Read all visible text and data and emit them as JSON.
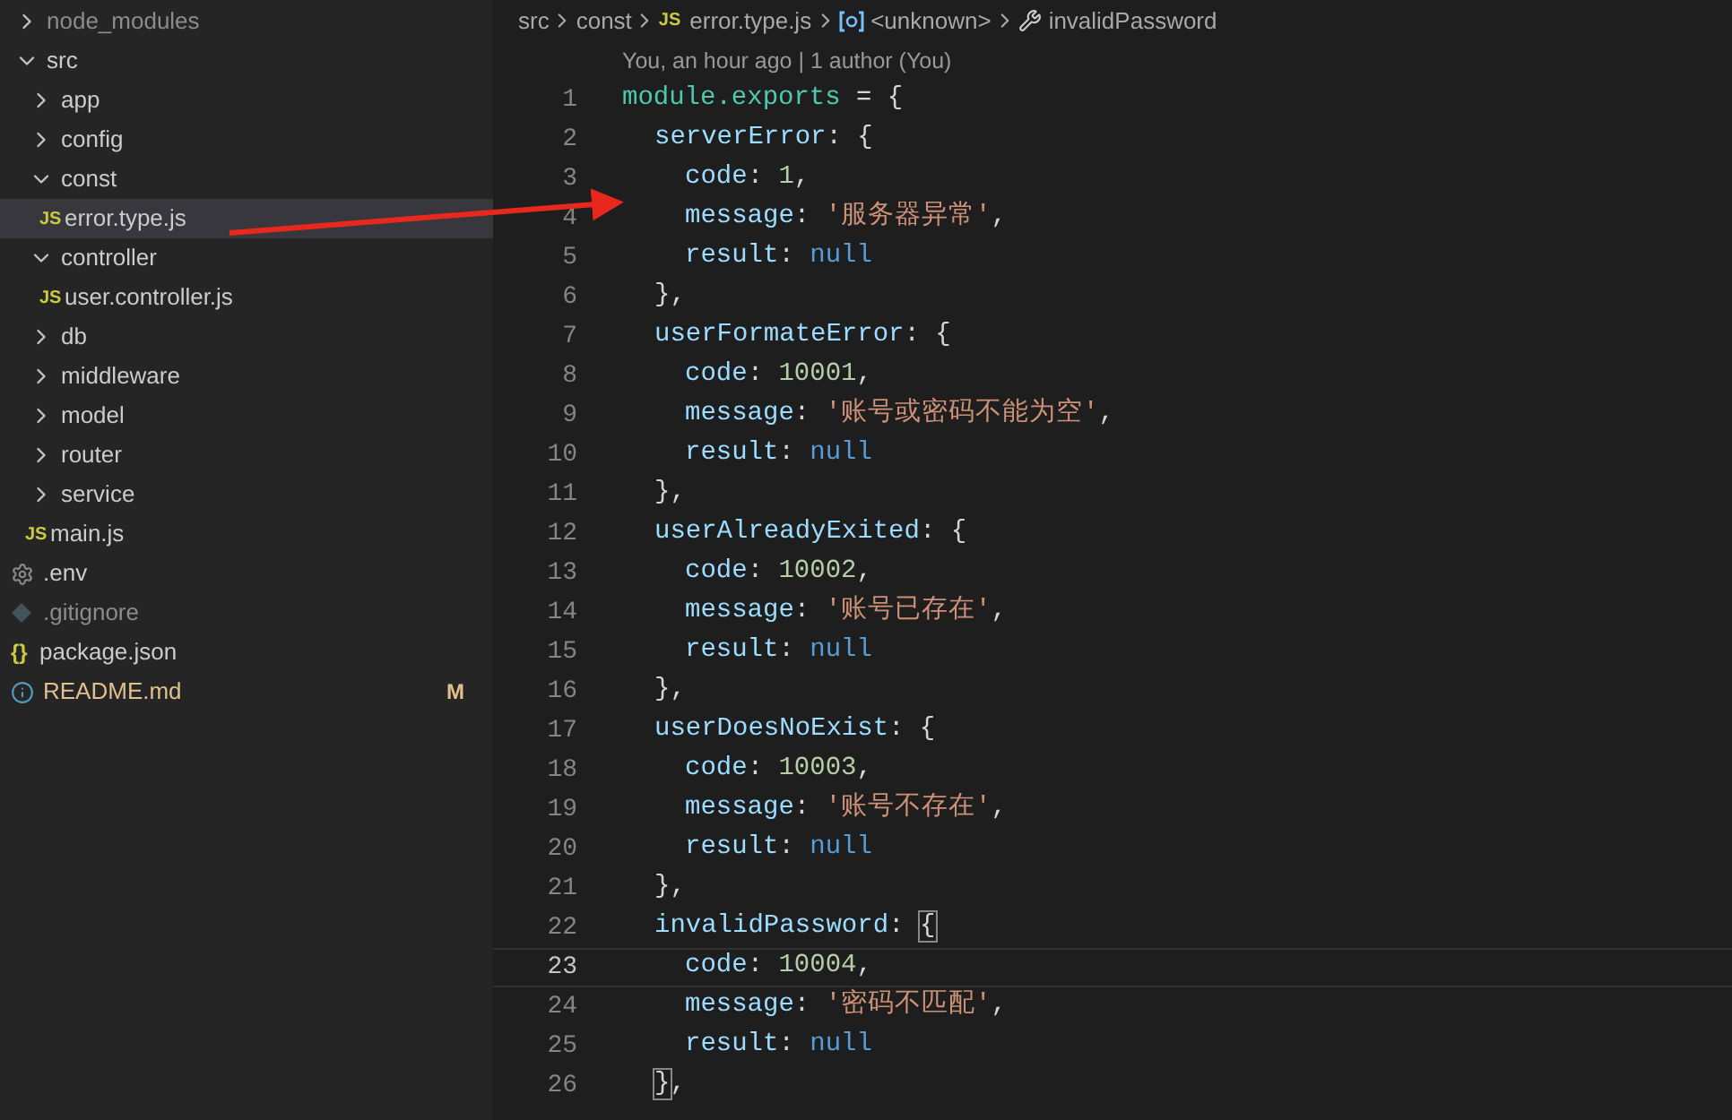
{
  "explorer": {
    "items": [
      {
        "kind": "folder",
        "label": "node_modules",
        "expanded": false,
        "dimmed": true
      },
      {
        "kind": "folder",
        "label": "src",
        "expanded": true,
        "children": [
          {
            "kind": "folder",
            "label": "app",
            "expanded": false
          },
          {
            "kind": "folder",
            "label": "config",
            "expanded": false
          },
          {
            "kind": "folder",
            "label": "const",
            "expanded": true,
            "children": [
              {
                "kind": "js",
                "icon": "JS",
                "label": "error.type.js",
                "selected": true
              }
            ]
          },
          {
            "kind": "folder",
            "label": "controller",
            "expanded": true,
            "children": [
              {
                "kind": "js",
                "icon": "JS",
                "label": "user.controller.js",
                "selected": false
              }
            ]
          },
          {
            "kind": "folder",
            "label": "db",
            "expanded": false
          },
          {
            "kind": "folder",
            "label": "middleware",
            "expanded": false
          },
          {
            "kind": "folder",
            "label": "model",
            "expanded": false
          },
          {
            "kind": "folder",
            "label": "router",
            "expanded": false
          },
          {
            "kind": "folder",
            "label": "service",
            "expanded": false
          },
          {
            "kind": "js",
            "icon": "JS",
            "label": "main.js",
            "selected": false
          }
        ]
      },
      {
        "kind": "settings",
        "label": ".env",
        "selected": false
      },
      {
        "kind": "git",
        "label": ".gitignore",
        "selected": false,
        "dimmed": true
      },
      {
        "kind": "json",
        "icon": "{}",
        "label": "package.json",
        "selected": false
      },
      {
        "kind": "info",
        "label": "README.md",
        "selected": false,
        "badge": "M"
      }
    ]
  },
  "breadcrumb": [
    {
      "kind": "folder",
      "label": "src"
    },
    {
      "kind": "folder",
      "label": "const"
    },
    {
      "kind": "file",
      "icon": "JS",
      "label": "error.type.js"
    },
    {
      "kind": "variable",
      "label": "<unknown>"
    },
    {
      "kind": "property",
      "label": "invalidPassword"
    }
  ],
  "codelens": "You, an hour ago | 1 author (You)",
  "lines": [
    {
      "number": "1",
      "kind": "root",
      "current": false,
      "tokens": [
        {
          "kind": "module",
          "text": "module.exports"
        },
        {
          "kind": "punct",
          "text": " = {"
        }
      ]
    },
    {
      "number": "2",
      "kind": "member",
      "current": false,
      "tokens": [
        {
          "kind": "key",
          "text": "serverError"
        },
        {
          "kind": "punct",
          "text": ": {"
        }
      ]
    },
    {
      "number": "3",
      "kind": "field",
      "current": false,
      "tokens": [
        {
          "kind": "key",
          "text": "code"
        },
        {
          "kind": "punct",
          "text": ": "
        },
        {
          "kind": "number",
          "text": "1"
        },
        {
          "kind": "punct",
          "text": ","
        }
      ]
    },
    {
      "number": "4",
      "kind": "field",
      "current": false,
      "tokens": [
        {
          "kind": "key",
          "text": "message"
        },
        {
          "kind": "punct",
          "text": ": "
        },
        {
          "kind": "string",
          "text": "'服务器异常'"
        },
        {
          "kind": "punct",
          "text": ","
        }
      ]
    },
    {
      "number": "5",
      "kind": "field",
      "current": false,
      "tokens": [
        {
          "kind": "key",
          "text": "result"
        },
        {
          "kind": "punct",
          "text": ": "
        },
        {
          "kind": "null",
          "text": "null"
        }
      ]
    },
    {
      "number": "6",
      "kind": "member",
      "current": false,
      "tokens": [
        {
          "kind": "punct",
          "text": "},"
        }
      ]
    },
    {
      "number": "7",
      "kind": "member",
      "current": false,
      "tokens": [
        {
          "kind": "key",
          "text": "userFormateError"
        },
        {
          "kind": "punct",
          "text": ": {"
        }
      ]
    },
    {
      "number": "8",
      "kind": "field",
      "current": false,
      "tokens": [
        {
          "kind": "key",
          "text": "code"
        },
        {
          "kind": "punct",
          "text": ": "
        },
        {
          "kind": "number",
          "text": "10001"
        },
        {
          "kind": "punct",
          "text": ","
        }
      ]
    },
    {
      "number": "9",
      "kind": "field",
      "current": false,
      "tokens": [
        {
          "kind": "key",
          "text": "message"
        },
        {
          "kind": "punct",
          "text": ": "
        },
        {
          "kind": "string",
          "text": "'账号或密码不能为空'"
        },
        {
          "kind": "punct",
          "text": ","
        }
      ]
    },
    {
      "number": "10",
      "kind": "field",
      "current": false,
      "tokens": [
        {
          "kind": "key",
          "text": "result"
        },
        {
          "kind": "punct",
          "text": ": "
        },
        {
          "kind": "null",
          "text": "null"
        }
      ]
    },
    {
      "number": "11",
      "kind": "member",
      "current": false,
      "tokens": [
        {
          "kind": "punct",
          "text": "},"
        }
      ]
    },
    {
      "number": "12",
      "kind": "member",
      "current": false,
      "tokens": [
        {
          "kind": "key",
          "text": "userAlreadyExited"
        },
        {
          "kind": "punct",
          "text": ": {"
        }
      ]
    },
    {
      "number": "13",
      "kind": "field",
      "current": false,
      "tokens": [
        {
          "kind": "key",
          "text": "code"
        },
        {
          "kind": "punct",
          "text": ": "
        },
        {
          "kind": "number",
          "text": "10002"
        },
        {
          "kind": "punct",
          "text": ","
        }
      ]
    },
    {
      "number": "14",
      "kind": "field",
      "current": false,
      "tokens": [
        {
          "kind": "key",
          "text": "message"
        },
        {
          "kind": "punct",
          "text": ": "
        },
        {
          "kind": "string",
          "text": "'账号已存在'"
        },
        {
          "kind": "punct",
          "text": ","
        }
      ]
    },
    {
      "number": "15",
      "kind": "field",
      "current": false,
      "tokens": [
        {
          "kind": "key",
          "text": "result"
        },
        {
          "kind": "punct",
          "text": ": "
        },
        {
          "kind": "null",
          "text": "null"
        }
      ]
    },
    {
      "number": "16",
      "kind": "member",
      "current": false,
      "tokens": [
        {
          "kind": "punct",
          "text": "},"
        }
      ]
    },
    {
      "number": "17",
      "kind": "member",
      "current": false,
      "tokens": [
        {
          "kind": "key",
          "text": "userDoesNoExist"
        },
        {
          "kind": "punct",
          "text": ": {"
        }
      ]
    },
    {
      "number": "18",
      "kind": "field",
      "current": false,
      "tokens": [
        {
          "kind": "key",
          "text": "code"
        },
        {
          "kind": "punct",
          "text": ": "
        },
        {
          "kind": "number",
          "text": "10003"
        },
        {
          "kind": "punct",
          "text": ","
        }
      ]
    },
    {
      "number": "19",
      "kind": "field",
      "current": false,
      "tokens": [
        {
          "kind": "key",
          "text": "message"
        },
        {
          "kind": "punct",
          "text": ": "
        },
        {
          "kind": "string",
          "text": "'账号不存在'"
        },
        {
          "kind": "punct",
          "text": ","
        }
      ]
    },
    {
      "number": "20",
      "kind": "field",
      "current": false,
      "tokens": [
        {
          "kind": "key",
          "text": "result"
        },
        {
          "kind": "punct",
          "text": ": "
        },
        {
          "kind": "null",
          "text": "null"
        }
      ]
    },
    {
      "number": "21",
      "kind": "member",
      "current": false,
      "tokens": [
        {
          "kind": "punct",
          "text": "},"
        }
      ]
    },
    {
      "number": "22",
      "kind": "member",
      "current": false,
      "tokens": [
        {
          "kind": "key",
          "text": "invalidPassword"
        },
        {
          "kind": "punct",
          "text": ": "
        },
        {
          "kind": "bracket",
          "text": "{"
        }
      ]
    },
    {
      "number": "23",
      "kind": "field",
      "current": true,
      "tokens": [
        {
          "kind": "key",
          "text": "code"
        },
        {
          "kind": "punct",
          "text": ": "
        },
        {
          "kind": "number",
          "text": "10004"
        },
        {
          "kind": "punct",
          "text": ","
        }
      ]
    },
    {
      "number": "24",
      "kind": "field",
      "current": false,
      "tokens": [
        {
          "kind": "key",
          "text": "message"
        },
        {
          "kind": "punct",
          "text": ": "
        },
        {
          "kind": "string",
          "text": "'密码不匹配'"
        },
        {
          "kind": "punct",
          "text": ","
        }
      ]
    },
    {
      "number": "25",
      "kind": "field",
      "current": false,
      "tokens": [
        {
          "kind": "key",
          "text": "result"
        },
        {
          "kind": "punct",
          "text": ": "
        },
        {
          "kind": "null",
          "text": "null"
        }
      ]
    },
    {
      "number": "26",
      "kind": "member",
      "current": false,
      "tokens": [
        {
          "kind": "bracket",
          "text": "}"
        },
        {
          "kind": "punct",
          "text": ","
        }
      ]
    }
  ]
}
